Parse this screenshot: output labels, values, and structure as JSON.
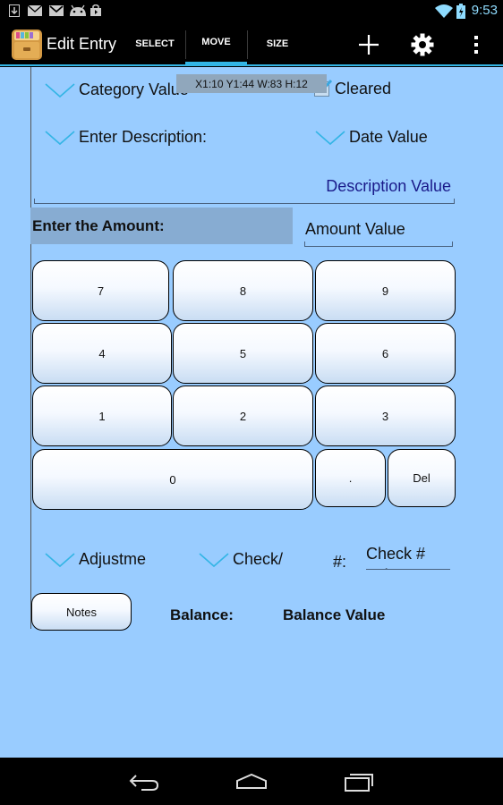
{
  "status_bar": {
    "time": "9:53",
    "left_icons": [
      "download-icon",
      "mail-icon",
      "gmail-icon",
      "android-icon",
      "store-icon"
    ],
    "right_icons": [
      "wifi-icon",
      "battery-icon"
    ],
    "accent_color": "#8fdcff"
  },
  "action_bar": {
    "title": "Edit Entry",
    "tabs": [
      {
        "label": "SELECT",
        "selected": false
      },
      {
        "label": "MOVE",
        "selected": true
      },
      {
        "label": "SIZE",
        "selected": false
      }
    ],
    "actions": [
      "add-icon",
      "settings-icon",
      "overflow-menu-icon"
    ],
    "accent_color": "#33b5e5"
  },
  "form": {
    "category_spinner": "Category Value",
    "edit_overlay": "X1:10 Y1:44 W:83 H:12",
    "cleared_label": "Cleared",
    "cleared_checked": true,
    "description_spinner": "Enter Description:",
    "date_spinner": "Date Value",
    "description_value": "Description Value",
    "amount_label": "Enter the Amount:",
    "amount_value": "Amount Value",
    "adjustment_spinner": "Adjustme",
    "check_spinner": "Check/",
    "check_number_label": "#:",
    "check_number_value": "Check # Value",
    "notes_button": "Notes",
    "balance_label": "Balance:",
    "balance_value": "Balance Value",
    "background_color": "#99ccff"
  },
  "keypad": {
    "rows": [
      [
        "7",
        "8",
        "9"
      ],
      [
        "4",
        "5",
        "6"
      ],
      [
        "1",
        "2",
        "3"
      ]
    ],
    "zero": "0",
    "decimal": ".",
    "delete": "Del"
  },
  "nav_bar": {
    "buttons": [
      "back-icon",
      "home-icon",
      "recent-apps-icon"
    ]
  }
}
